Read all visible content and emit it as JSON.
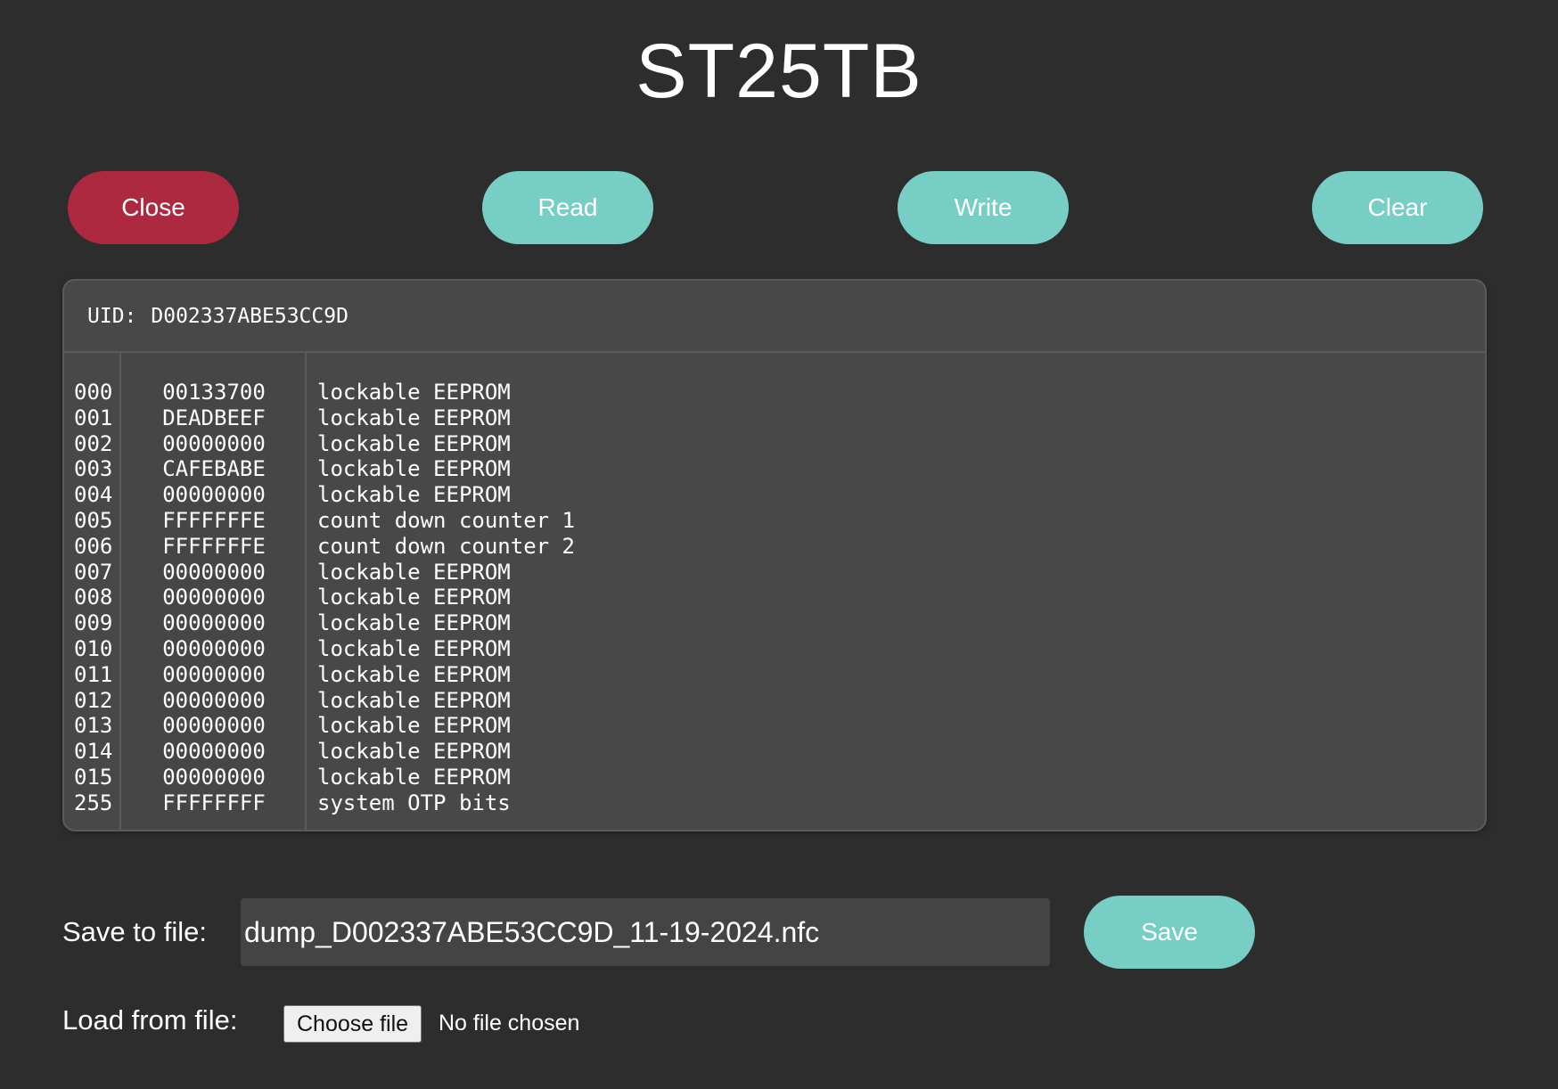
{
  "title": "ST25TB",
  "toolbar": {
    "close_label": "Close",
    "read_label": "Read",
    "write_label": "Write",
    "clear_label": "Clear"
  },
  "dump": {
    "uid_label": "UID:",
    "uid_value": "D002337ABE53CC9D",
    "rows": [
      {
        "index": "000",
        "hex": "00133700",
        "desc": "lockable EEPROM"
      },
      {
        "index": "001",
        "hex": "DEADBEEF",
        "desc": "lockable EEPROM"
      },
      {
        "index": "002",
        "hex": "00000000",
        "desc": "lockable EEPROM"
      },
      {
        "index": "003",
        "hex": "CAFEBABE",
        "desc": "lockable EEPROM"
      },
      {
        "index": "004",
        "hex": "00000000",
        "desc": "lockable EEPROM"
      },
      {
        "index": "005",
        "hex": "FFFFFFFE",
        "desc": "count down counter 1"
      },
      {
        "index": "006",
        "hex": "FFFFFFFE",
        "desc": "count down counter 2"
      },
      {
        "index": "007",
        "hex": "00000000",
        "desc": "lockable EEPROM"
      },
      {
        "index": "008",
        "hex": "00000000",
        "desc": "lockable EEPROM"
      },
      {
        "index": "009",
        "hex": "00000000",
        "desc": "lockable EEPROM"
      },
      {
        "index": "010",
        "hex": "00000000",
        "desc": "lockable EEPROM"
      },
      {
        "index": "011",
        "hex": "00000000",
        "desc": "lockable EEPROM"
      },
      {
        "index": "012",
        "hex": "00000000",
        "desc": "lockable EEPROM"
      },
      {
        "index": "013",
        "hex": "00000000",
        "desc": "lockable EEPROM"
      },
      {
        "index": "014",
        "hex": "00000000",
        "desc": "lockable EEPROM"
      },
      {
        "index": "015",
        "hex": "00000000",
        "desc": "lockable EEPROM"
      },
      {
        "index": "255",
        "hex": "FFFFFFFF",
        "desc": "system OTP bits"
      }
    ]
  },
  "save": {
    "label": "Save to file:",
    "filename": "dump_D002337ABE53CC9D_11-19-2024.nfc",
    "button_label": "Save"
  },
  "load": {
    "label": "Load from file:",
    "choose_label": "Choose file",
    "status": "No file chosen"
  },
  "colors": {
    "background": "#2d2d2d",
    "panel": "#484848",
    "danger": "#ad2940",
    "accent": "#77cec4"
  }
}
